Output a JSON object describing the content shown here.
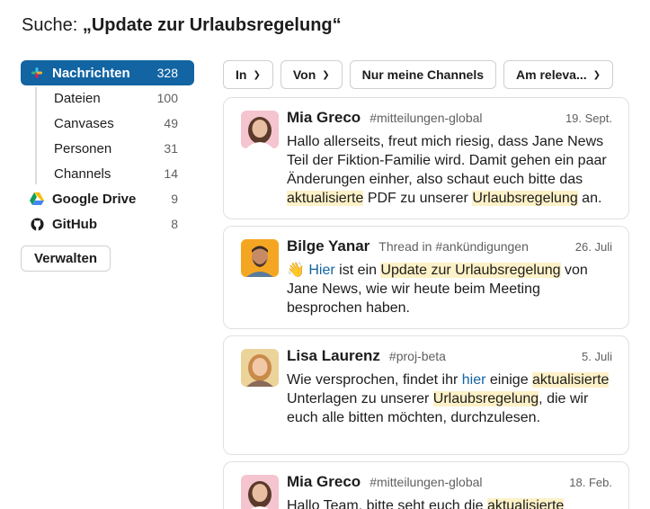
{
  "search": {
    "prefix": "Suche:",
    "query": "„Update zur Urlaubsregelung“"
  },
  "sidebar": {
    "items": [
      {
        "label": "Nachrichten",
        "count": "328"
      },
      {
        "label": "Dateien",
        "count": "100"
      },
      {
        "label": "Canvases",
        "count": "49"
      },
      {
        "label": "Personen",
        "count": "31"
      },
      {
        "label": "Channels",
        "count": "14"
      },
      {
        "label": "Google Drive",
        "count": "9"
      },
      {
        "label": "GitHub",
        "count": "8"
      }
    ],
    "manage_label": "Verwalten"
  },
  "filters": [
    {
      "label": "In"
    },
    {
      "label": "Von"
    },
    {
      "label": "Nur meine Channels"
    },
    {
      "label": "Am releva..."
    }
  ],
  "results": [
    {
      "name": "Mia Greco",
      "channel": "#mitteilungen-global",
      "date": "19. Sept.",
      "text_1": "Hallo allerseits, freut mich riesig, dass Jane News Teil der Fiktion-Familie wird. Damit gehen ein paar Änderungen einher, also schaut euch bitte das ",
      "hl_1": "aktualisierte",
      "text_2": " PDF zu unserer ",
      "hl_2": "Urlaubsregelung",
      "text_3": " an."
    },
    {
      "name": "Bilge Yanar",
      "channel": "Thread in #ankündigungen",
      "date": "26. Juli",
      "emoji": "👋",
      "link": "Hier",
      "text_1": " ist ein ",
      "hl_1": "Update zur Urlaubsregelung",
      "text_2": " von Jane News, wie wir heute beim Meeting besprochen haben."
    },
    {
      "name": "Lisa Laurenz",
      "channel": "#proj-beta",
      "date": "5. Juli",
      "text_1": "Wie versprochen, findet ihr ",
      "link": "hier",
      "text_2": " einige ",
      "hl_1": "aktualisierte",
      "text_3": " Unterlagen zu unserer ",
      "hl_2": "Urlaubsregelung",
      "text_4": ", die wir euch alle bitten möchten, durchzulesen."
    },
    {
      "name": "Mia Greco",
      "channel": "#mitteilungen-global",
      "date": "18. Feb.",
      "text_1": "Hallo Team, bitte seht euch die ",
      "hl_1": "aktualisierte"
    }
  ],
  "colors": {
    "accent": "#1264a3",
    "highlight": "#fdf1c7"
  }
}
